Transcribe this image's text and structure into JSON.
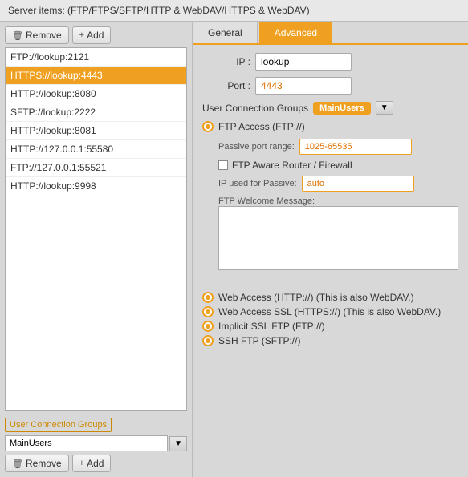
{
  "title": "Server items: (FTP/FTPS/SFTP/HTTP & WebDAV/HTTPS & WebDAV)",
  "left_panel": {
    "buttons": {
      "remove": "Remove",
      "add": "Add"
    },
    "server_list": [
      {
        "label": "FTP://lookup:2121",
        "selected": false
      },
      {
        "label": "HTTPS://lookup:4443",
        "selected": true
      },
      {
        "label": "HTTP://lookup:8080",
        "selected": false
      },
      {
        "label": "SFTP://lookup:2222",
        "selected": false
      },
      {
        "label": "HTTP://lookup:8081",
        "selected": false
      },
      {
        "label": "HTTP://127.0.0.1:55580",
        "selected": false
      },
      {
        "label": "FTP://127.0.0.1:55521",
        "selected": false
      },
      {
        "label": "HTTP://lookup:9998",
        "selected": false
      }
    ],
    "user_connection_groups": {
      "label": "User Connection Groups",
      "selected": "MainUsers",
      "options": [
        "MainUsers"
      ],
      "remove": "Remove",
      "add": "Add"
    }
  },
  "right_panel": {
    "tabs": [
      {
        "label": "General",
        "active": false
      },
      {
        "label": "Advanced",
        "active": true
      }
    ],
    "form": {
      "ip_label": "IP :",
      "ip_value": "lookup",
      "port_label": "Port :",
      "port_value": "4443",
      "user_connection_label": "User Connection Groups",
      "user_connection_value": "MainUsers",
      "ftp_access_label": "FTP Access (FTP://)",
      "passive_port_label": "Passive port range:",
      "passive_port_value": "1025-65535",
      "ftp_router_label": "FTP Aware Router / Firewall",
      "ip_used_label": "IP used for Passive:",
      "ip_used_value": "auto",
      "welcome_label": "FTP Welcome Message:",
      "welcome_value": "",
      "web_access_label": "Web Access (HTTP://) (This is also WebDAV.)",
      "web_access_ssl_label": "Web Access SSL (HTTPS://) (This is also WebDAV.)",
      "implicit_ssl_label": "Implicit SSL FTP (FTP://)",
      "ssh_ftp_label": "SSH FTP (SFTP://)"
    }
  }
}
